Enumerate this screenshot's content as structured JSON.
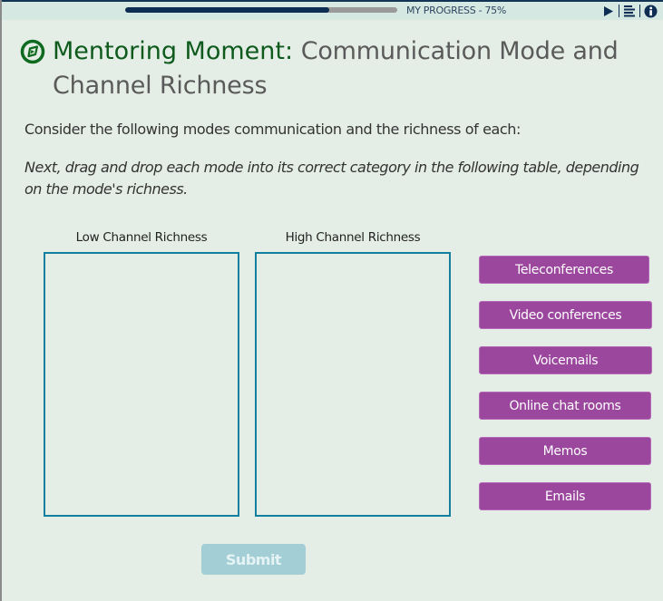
{
  "progress": {
    "label": "MY PROGRESS - 75%",
    "percent": 75,
    "fill_color": "#0d2e52",
    "track_color": "#9a9a9a"
  },
  "toolbar": {
    "icons": [
      "play-icon",
      "menu-icon",
      "info-icon"
    ]
  },
  "header": {
    "icon": "compass-icon",
    "title_strong": "Mentoring Moment:",
    "title_rest": "Communication Mode and Channel Richness",
    "accent_color": "#0e5a1c"
  },
  "content": {
    "intro": "Consider the following modes communication and the richness of each:",
    "instructions": "Next, drag and drop each mode into its correct category in the following table, depending on the mode's richness."
  },
  "categories": [
    {
      "label": "Low Channel Richness",
      "items": []
    },
    {
      "label": "High Channel Richness",
      "items": []
    }
  ],
  "drag_items": [
    {
      "label": "Teleconferences"
    },
    {
      "label": "Video conferences"
    },
    {
      "label": "Voicemails"
    },
    {
      "label": "Online chat rooms"
    },
    {
      "label": "Memos"
    },
    {
      "label": "Emails"
    }
  ],
  "drag_item_color": "#9b479e",
  "submit": {
    "label": "Submit",
    "disabled": true,
    "color": "#a3ced5"
  }
}
